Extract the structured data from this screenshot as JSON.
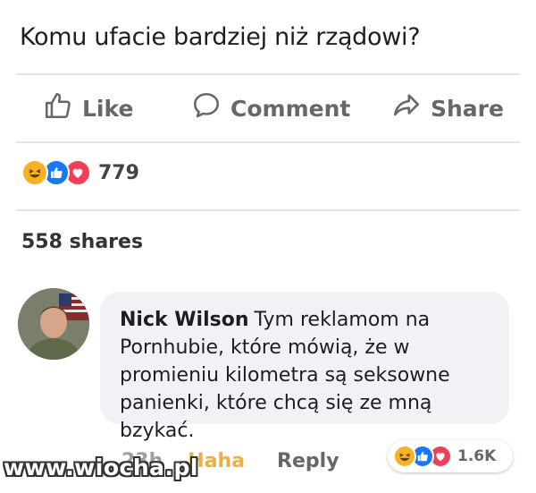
{
  "post": {
    "text": "Komu ufacie bardziej niż rządowi?"
  },
  "actions": {
    "like_label": "Like",
    "comment_label": "Comment",
    "share_label": "Share"
  },
  "reactions": {
    "types": [
      "haha",
      "like",
      "love"
    ],
    "count": "779"
  },
  "shares": {
    "label": "558 shares"
  },
  "comment": {
    "author": "Nick Wilson",
    "text": "Tym reklamom na Pornhubie, które mówią, że w promieniu kilometra są seksowne panienki, które chcą się ze mną bzykać.",
    "time": "23h",
    "reaction_action": "Haha",
    "reply_label": "Reply",
    "reactions": {
      "types": [
        "haha",
        "like",
        "love"
      ],
      "count": "1.6K"
    }
  },
  "watermark": "www.wiocha.pl",
  "colors": {
    "like_blue": "#1877f2",
    "love_red": "#f33e58",
    "haha_yellow": "#f7b125",
    "secondary_text": "#65676b",
    "bubble_bg": "#f0f2f5"
  }
}
